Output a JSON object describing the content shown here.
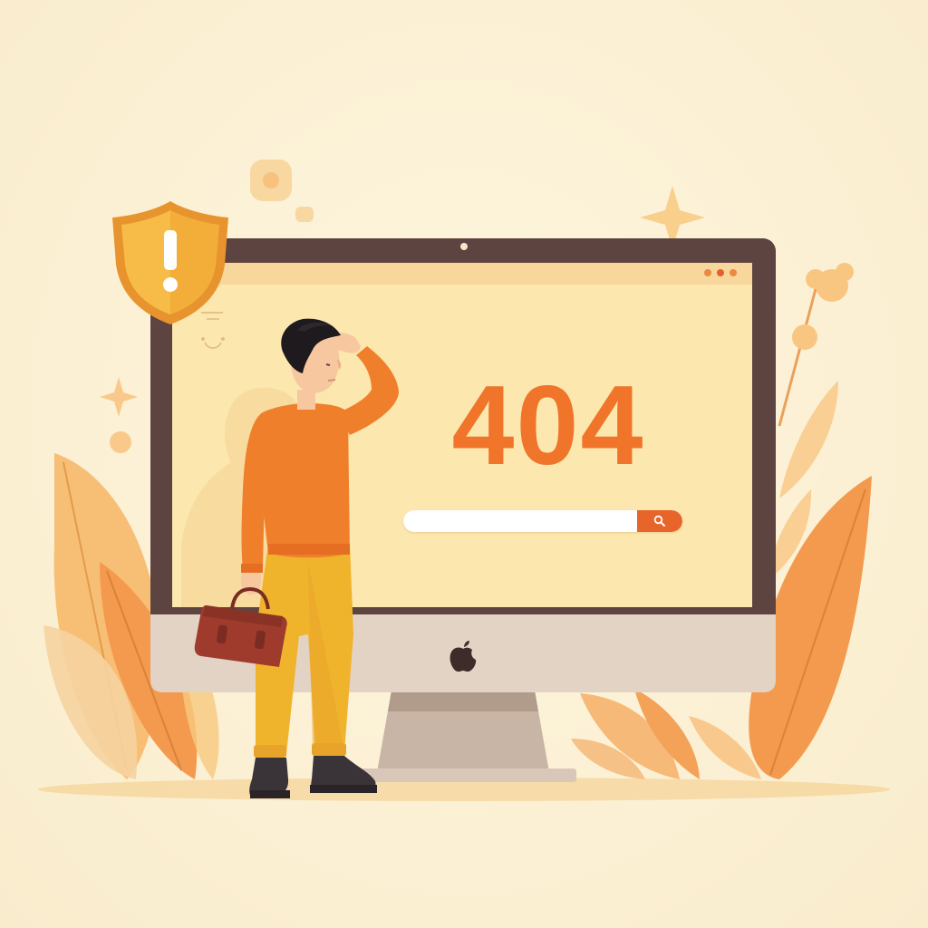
{
  "error": {
    "code": "404"
  },
  "search": {
    "value": "",
    "placeholder": "",
    "button_icon": "search-icon"
  },
  "window": {
    "controls": [
      "window-dot-1",
      "window-dot-2",
      "window-dot-3"
    ]
  },
  "icons": {
    "warning_shield": "warning-shield-icon",
    "computer_logo": "apple-logo-icon"
  },
  "colors": {
    "background": "#FCF3D8",
    "accent": "#F0742A",
    "bezel": "#5E4440",
    "screen": "#FCE7AE",
    "shirt": "#F07F2C",
    "pants": "#F0B32C",
    "bag": "#9E3B2D",
    "foliage": "#F3A257"
  }
}
